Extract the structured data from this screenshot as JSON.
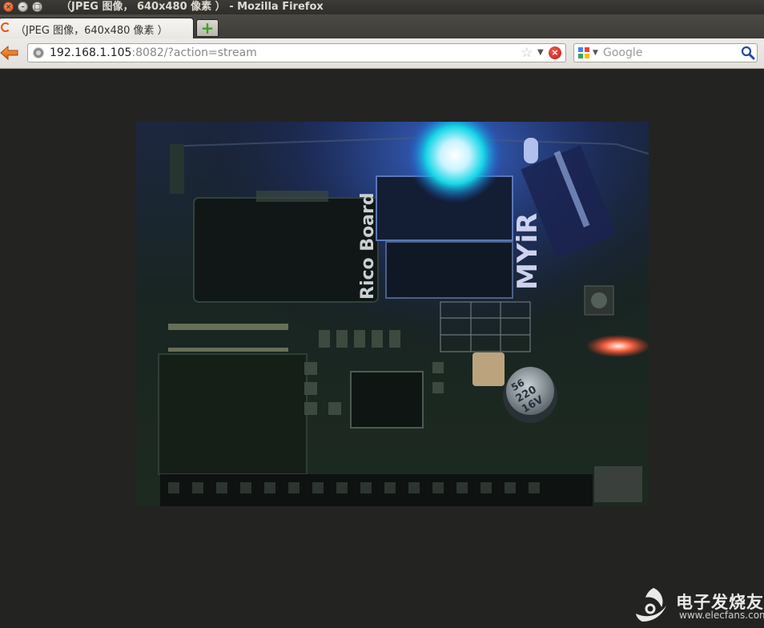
{
  "window": {
    "title": "（JPEG 图像， 640x480 像素 ） - Mozilla Firefox",
    "close_glyph": "×",
    "min_glyph": "–",
    "max_glyph": "□"
  },
  "tabs": [
    {
      "label": "（JPEG 图像，640x480 像素 ）",
      "icon": "firefox-loading-icon"
    }
  ],
  "newtab": {
    "glyph": "+"
  },
  "urlbar": {
    "host": "192.168.1.105",
    "rest": ":8082/?action=stream"
  },
  "search": {
    "engine": "Google",
    "placeholder": "Google"
  },
  "page": {
    "image_label": "Rico Board",
    "image_brand": "MYiR",
    "cap_values": [
      "56",
      "220",
      "16V"
    ]
  },
  "watermark": {
    "name": "电子发烧友",
    "url": "www.elecfans.com"
  },
  "colors": {
    "accent": "#e8530e",
    "led_blue": "#2a7bff",
    "led_red": "#ff5a3c"
  }
}
